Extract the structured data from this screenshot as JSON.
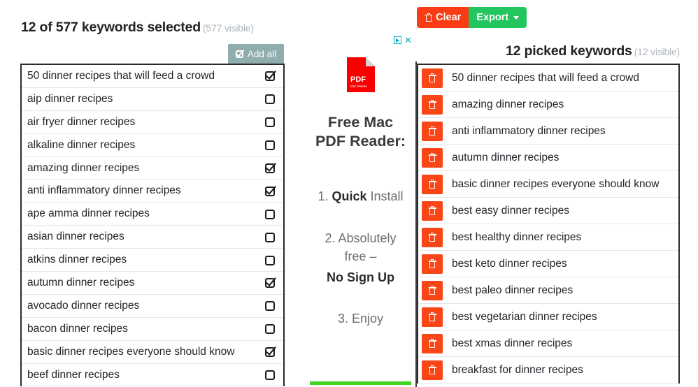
{
  "toolbar": {
    "clear_label": "Clear",
    "clear_icon": "trash-icon",
    "clear_color": "#fa3c14",
    "export_label": "Export",
    "export_icon": "caret-down-icon",
    "export_color": "#22c55e"
  },
  "left": {
    "heading_main": "12 of 577 keywords selected",
    "heading_muted": "(577 visible)",
    "add_all_label": "Add all",
    "add_all_icon": "checkbox-checked-icon",
    "add_all_color": "#8fadad",
    "keywords": [
      {
        "label": "50 dinner recipes that will feed a crowd",
        "checked": true
      },
      {
        "label": "aip dinner recipes",
        "checked": false
      },
      {
        "label": "air fryer dinner recipes",
        "checked": false
      },
      {
        "label": "alkaline dinner recipes",
        "checked": false
      },
      {
        "label": "amazing dinner recipes",
        "checked": true
      },
      {
        "label": "anti inflammatory dinner recipes",
        "checked": true
      },
      {
        "label": "ape amma dinner recipes",
        "checked": false
      },
      {
        "label": "asian dinner recipes",
        "checked": false
      },
      {
        "label": "atkins dinner recipes",
        "checked": false
      },
      {
        "label": "autumn dinner recipes",
        "checked": true
      },
      {
        "label": "avocado dinner recipes",
        "checked": false
      },
      {
        "label": "bacon dinner recipes",
        "checked": false
      },
      {
        "label": "basic dinner recipes everyone should know",
        "checked": true
      },
      {
        "label": "beef dinner recipes",
        "checked": false
      }
    ]
  },
  "ad": {
    "adchoices_icon": "adchoices-triangle-icon",
    "close_icon": "close-x-icon",
    "close_label": "✕",
    "logo_main_text": "PDF",
    "logo_sub_text": "Mac Master",
    "logo_color": "#f60000",
    "title_line_1": "Free Mac",
    "title_line_2": "PDF Reader:",
    "step_1_prefix": "1. ",
    "step_1_bold": "Quick",
    "step_1_suffix": " Install",
    "step_2_line_1": "2. Absolutely",
    "step_2_line_2": "free –",
    "step_2_bold": "No Sign Up",
    "step_3": "3. Enjoy",
    "accent_bar_color": "#3fd520"
  },
  "right": {
    "heading_main": "12 picked keywords",
    "heading_muted": "(12 visible)",
    "delete_icon": "trash-icon",
    "delete_button_color": "#fa4616",
    "picked": [
      "50 dinner recipes that will feed a crowd",
      "amazing dinner recipes",
      "anti inflammatory dinner recipes",
      "autumn dinner recipes",
      "basic dinner recipes everyone should know",
      "best easy dinner recipes",
      "best healthy dinner recipes",
      "best keto dinner recipes",
      "best paleo dinner recipes",
      "best vegetarian dinner recipes",
      "best xmas dinner recipes",
      "breakfast for dinner recipes"
    ]
  }
}
